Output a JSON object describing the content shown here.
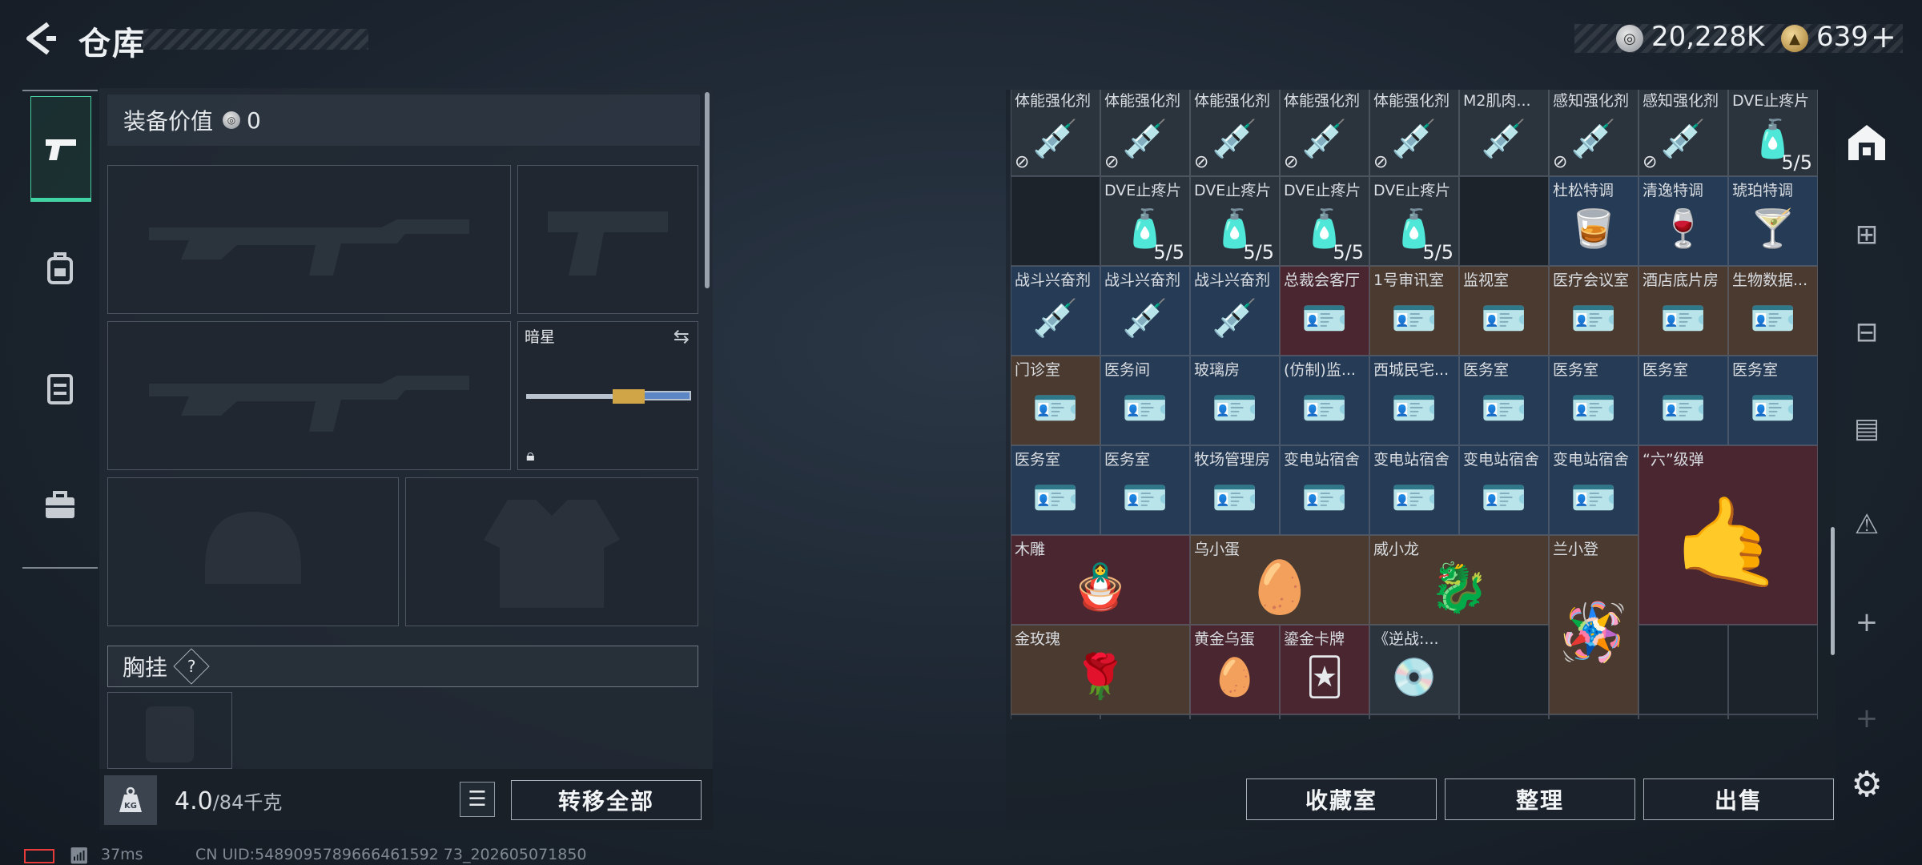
{
  "header": {
    "title": "仓库",
    "silver_amount": "20,228K",
    "gold_amount": "639",
    "plus": "+"
  },
  "left_rail": [
    "weapon-tab",
    "backpack-tab",
    "rig-tab",
    "case-tab"
  ],
  "equipment": {
    "value_label": "装备价值",
    "value": "0",
    "melee_name": "暗星",
    "chest_label": "胸挂",
    "chest_help": "?",
    "weight_value": "4.0",
    "weight_max": "/84千克",
    "kg_badge": "KG",
    "transfer_all": "转移全部"
  },
  "grid": {
    "row1": [
      "体能强化剂",
      "体能强化剂",
      "体能强化剂",
      "体能强化剂",
      "体能强化剂",
      "M2肌肉...",
      "感知强化剂",
      "感知强化剂",
      "DVE止疼片"
    ],
    "row1_count": "5/5",
    "row2": [
      "DVE止疼片",
      "DVE止疼片",
      "DVE止疼片",
      "DVE止疼片",
      "杜松特调",
      "清逸特调",
      "琥珀特调"
    ],
    "row2_count": "5/5",
    "row3": [
      "战斗兴奋剂",
      "战斗兴奋剂",
      "战斗兴奋剂",
      "总裁会客厅",
      "1号审讯室",
      "监视室",
      "医疗会议室",
      "酒店底片房",
      "生物数据..."
    ],
    "row4": [
      "门诊室",
      "医务间",
      "玻璃房",
      "(仿制)监...",
      "西城民宅...",
      "医务室",
      "医务室",
      "医务室",
      "医务室"
    ],
    "row5": [
      "医务室",
      "医务室",
      "牧场管理房",
      "变电站宿舍",
      "变电站宿舍",
      "变电站宿舍",
      "变电站宿舍",
      "“六”级弹"
    ],
    "row6": [
      "木雕",
      "乌小蛋",
      "威小龙",
      "兰小登"
    ],
    "row7": [
      "金玫瑰",
      "黄金乌蛋",
      "鎏金卡牌",
      "《逆战:..."
    ]
  },
  "actions": {
    "collection": "收藏室",
    "arrange": "整理",
    "sell": "出售"
  },
  "status": {
    "ping": "37ms",
    "uid": "CN UID:5489095789666461592 73_202605071850"
  },
  "colors": {
    "accent": "#3fd4a3",
    "cell_blue": "#263b55",
    "cell_brown": "#4a3a2f",
    "cell_red": "#4a2730",
    "battery": "#e53b3b"
  }
}
